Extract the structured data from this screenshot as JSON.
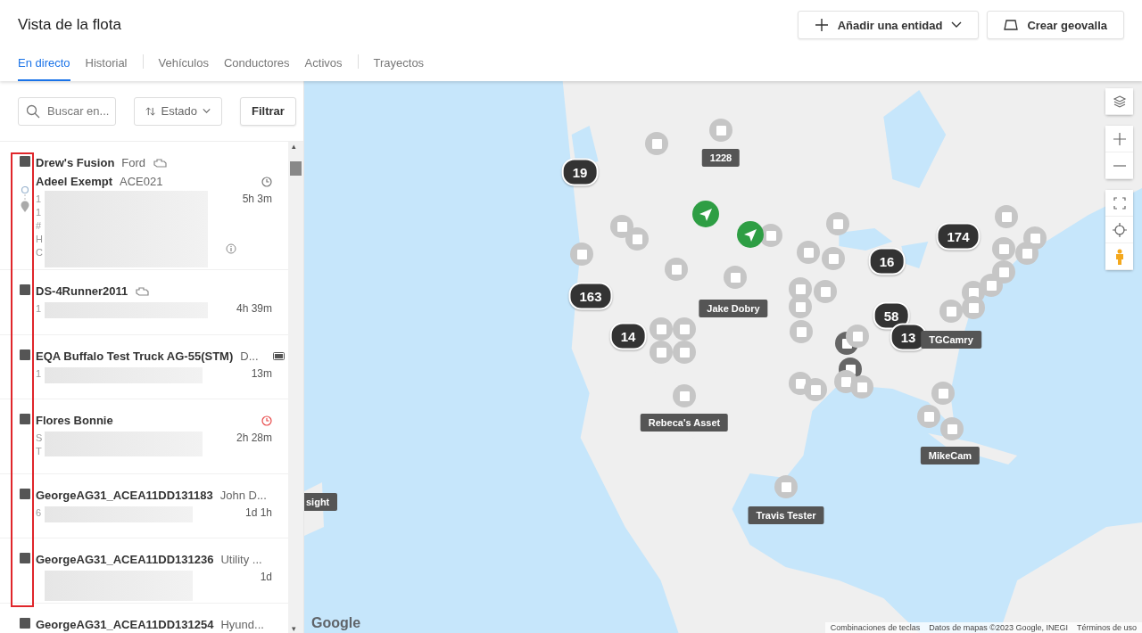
{
  "page_title": "Vista de la flota",
  "header_buttons": [
    {
      "kind": "add",
      "label": "Añadir una entidad"
    },
    {
      "kind": "geofence",
      "label": "Crear geovalla"
    }
  ],
  "tabs": [
    {
      "label": "En directo",
      "selected": true,
      "divider_after": false
    },
    {
      "label": "Historial",
      "selected": false,
      "divider_after": true
    },
    {
      "label": "Vehículos",
      "selected": false,
      "divider_after": false
    },
    {
      "label": "Conductores",
      "selected": false,
      "divider_after": false
    },
    {
      "label": "Activos",
      "selected": false,
      "divider_after": true
    },
    {
      "label": "Trayectos",
      "selected": false,
      "divider_after": false
    }
  ],
  "search": {
    "placeholder": "Buscar en..."
  },
  "sort": {
    "label": "Estado"
  },
  "filter_button": "Filtrar",
  "scroll_arrows": [
    "▴",
    "▾"
  ],
  "rows": [
    {
      "title": "Drew's Fusion",
      "detail": "Ford",
      "idle": true,
      "battery": false,
      "driver": "Adeel Exempt",
      "driver_code": "ACE021",
      "clock": true,
      "late": false,
      "lines": [
        "1",
        "1",
        "#",
        "H",
        "C"
      ],
      "route": true,
      "time": "5h 3m",
      "info": true
    },
    {
      "title": "DS-4Runner2011",
      "idle": true,
      "battery": false,
      "clock": false,
      "lines": [
        "1"
      ],
      "route": false,
      "time": "4h 39m",
      "info": false
    },
    {
      "title": "EQA Buffalo Test Truck AG-55(STM)",
      "detail": "D...",
      "idle": false,
      "battery": true,
      "clock": false,
      "lines": [
        "1"
      ],
      "route": false,
      "time": "13m",
      "info": false
    },
    {
      "title": "Flores Bonnie",
      "idle": false,
      "battery": false,
      "clock": true,
      "late": true,
      "lines": [
        "S",
        "T"
      ],
      "route": false,
      "time": "2h 28m",
      "info": false
    },
    {
      "title": "GeorgeAG31_ACEA11DD131183",
      "detail": "John D...",
      "idle": false,
      "battery": false,
      "clock": false,
      "lines": [
        "6"
      ],
      "route": false,
      "time": "1d 1h",
      "info": false
    },
    {
      "title": "GeorgeAG31_ACEA11DD131236",
      "detail": "Utility ...",
      "idle": false,
      "battery": false,
      "clock": false,
      "lines": [],
      "route": false,
      "time": "1d",
      "info": false
    },
    {
      "title": "GeorgeAG31_ACEA11DD131254",
      "detail": "Hyund...",
      "idle": false,
      "battery": false,
      "clock": false,
      "lines": [],
      "route": false,
      "info": false
    }
  ],
  "map": {
    "markers": [
      {
        "kind": "cluster",
        "text": "19"
      },
      {
        "kind": "cluster",
        "text": "163"
      },
      {
        "kind": "cluster",
        "text": "14"
      },
      {
        "kind": "cluster",
        "text": "174"
      },
      {
        "kind": "cluster",
        "text": "16"
      },
      {
        "kind": "cluster",
        "text": "58"
      },
      {
        "kind": "cluster",
        "text": "13"
      },
      {
        "kind": "asset"
      },
      {
        "kind": "asset"
      },
      {
        "kind": "asset"
      },
      {
        "kind": "asset"
      },
      {
        "kind": "asset"
      },
      {
        "kind": "asset"
      },
      {
        "kind": "asset"
      },
      {
        "kind": "asset"
      },
      {
        "kind": "asset"
      },
      {
        "kind": "asset"
      },
      {
        "kind": "asset"
      },
      {
        "kind": "asset"
      },
      {
        "kind": "asset"
      },
      {
        "kind": "asset"
      },
      {
        "kind": "asset"
      },
      {
        "kind": "stack"
      },
      {
        "kind": "stack"
      },
      {
        "kind": "asset"
      },
      {
        "kind": "asset"
      },
      {
        "kind": "asset"
      },
      {
        "kind": "asset"
      },
      {
        "kind": "asset"
      },
      {
        "kind": "asset"
      },
      {
        "kind": "asset"
      },
      {
        "kind": "asset"
      },
      {
        "kind": "asset"
      },
      {
        "kind": "asset"
      },
      {
        "kind": "asset"
      },
      {
        "kind": "asset"
      },
      {
        "kind": "asset"
      },
      {
        "kind": "asset"
      },
      {
        "kind": "asset"
      },
      {
        "kind": "asset"
      },
      {
        "kind": "asset"
      },
      {
        "kind": "asset"
      },
      {
        "kind": "asset"
      },
      {
        "kind": "asset"
      },
      {
        "kind": "asset"
      },
      {
        "kind": "asset"
      },
      {
        "kind": "asset"
      },
      {
        "kind": "vehicle"
      },
      {
        "kind": "vehicle"
      },
      {
        "kind": "label",
        "text": "1228"
      },
      {
        "kind": "label",
        "text": "Jake Dobry"
      },
      {
        "kind": "label",
        "text": "TGCamry"
      },
      {
        "kind": "label",
        "text": "Rebeca's Asset"
      },
      {
        "kind": "label",
        "text": "MikeCam"
      },
      {
        "kind": "label",
        "text": "Travis Tester"
      },
      {
        "kind": "label",
        "text": "sight"
      }
    ],
    "logo": "Google",
    "attribution": [
      "Combinaciones de teclas",
      "Datos de mapas ©2023 Google, INEGI",
      "Términos de uso"
    ]
  }
}
